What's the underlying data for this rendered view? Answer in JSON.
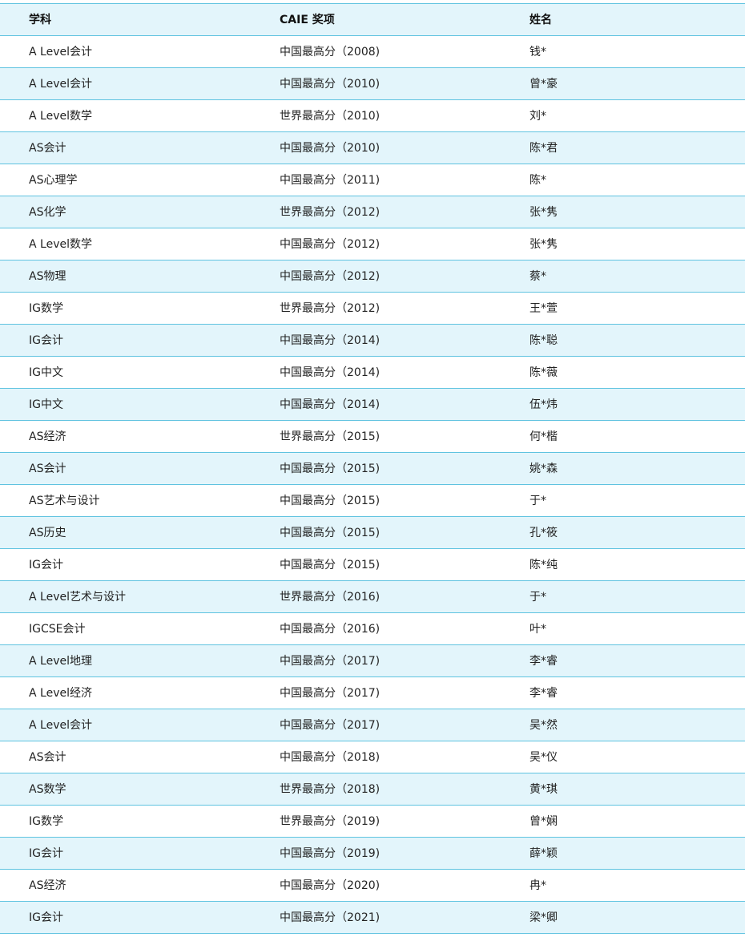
{
  "table": {
    "headers": [
      "学科",
      "CAIE 奖项",
      "姓名"
    ],
    "rows": [
      [
        "A Level会计",
        "中国最高分（2008)",
        "钱*"
      ],
      [
        "A Level会计",
        "中国最高分（2010)",
        "曾*豪"
      ],
      [
        "A Level数学",
        "世界最高分（2010)",
        "刘*"
      ],
      [
        "AS会计",
        "中国最高分（2010)",
        "陈*君"
      ],
      [
        "AS心理学",
        "中国最高分（2011)",
        "陈*"
      ],
      [
        "AS化学",
        "世界最高分（2012)",
        "张*隽"
      ],
      [
        "A Level数学",
        "中国最高分（2012)",
        "张*隽"
      ],
      [
        "AS物理",
        "中国最高分（2012)",
        "蔡*"
      ],
      [
        "IG数学",
        "世界最高分（2012)",
        "王*萱"
      ],
      [
        "IG会计",
        "中国最高分（2014)",
        "陈*聪"
      ],
      [
        "IG中文",
        "中国最高分（2014)",
        "陈*薇"
      ],
      [
        "IG中文",
        "中国最高分（2014)",
        "伍*炜"
      ],
      [
        "AS经济",
        "世界最高分（2015)",
        "何*楷"
      ],
      [
        "AS会计",
        "中国最高分（2015)",
        "姚*森"
      ],
      [
        "AS艺术与设计",
        "中国最高分（2015)",
        "于*"
      ],
      [
        "AS历史",
        "中国最高分（2015)",
        "孔*筱"
      ],
      [
        "IG会计",
        "中国最高分（2015)",
        "陈*纯"
      ],
      [
        "A Level艺术与设计",
        "世界最高分（2016)",
        "于*"
      ],
      [
        "IGCSE会计",
        "中国最高分（2016)",
        "叶*"
      ],
      [
        "A Level地理",
        "中国最高分（2017)",
        "李*睿"
      ],
      [
        "A Level经济",
        "中国最高分（2017)",
        "李*睿"
      ],
      [
        "A Level会计",
        "中国最高分（2017)",
        "吴*然"
      ],
      [
        "AS会计",
        "中国最高分（2018)",
        "吴*仪"
      ],
      [
        "AS数学",
        "世界最高分（2018)",
        "黄*琪"
      ],
      [
        "IG数学",
        "世界最高分（2019)",
        "曾*娴"
      ],
      [
        "IG会计",
        "中国最高分（2019)",
        "薛*颖"
      ],
      [
        "AS经济",
        "中国最高分（2020)",
        "冉*"
      ],
      [
        "IG会计",
        "中国最高分（2021)",
        "梁*卿"
      ]
    ]
  }
}
